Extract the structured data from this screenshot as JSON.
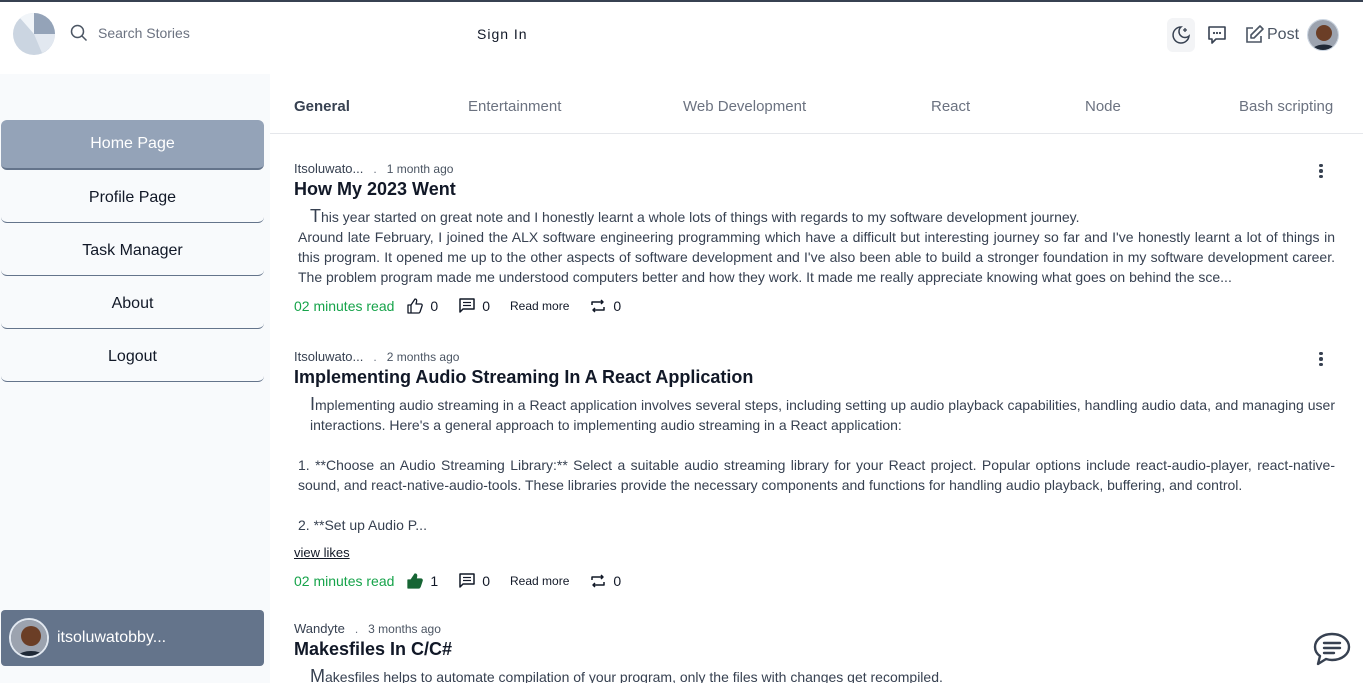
{
  "header": {
    "search_placeholder": "Search Stories",
    "signin_label": "Sign In",
    "post_label": "Post"
  },
  "sidebar": {
    "items": [
      {
        "label": "Home Page"
      },
      {
        "label": "Profile Page"
      },
      {
        "label": "Task Manager"
      },
      {
        "label": "About"
      },
      {
        "label": "Logout"
      }
    ],
    "user_name": "itsoluwatobby..."
  },
  "tabs": [
    {
      "label": "General"
    },
    {
      "label": "Entertainment"
    },
    {
      "label": "Web Development"
    },
    {
      "label": "React"
    },
    {
      "label": "Node"
    },
    {
      "label": "Bash scripting"
    }
  ],
  "posts": [
    {
      "author": "Itsoluwato...",
      "sep": ".",
      "ago": "1 month ago",
      "title": "How My 2023 Went",
      "p1": "This year started on great note and I honestly learnt a whole lots of things with regards to my software development journey.",
      "p2": "Around late February, I joined the ALX software engineering programming which have a difficult but interesting journey so far and I've honestly learnt a lot of things in this program. It opened me up to the other aspects of software development and I've also been able to build a stronger foundation in my software development career. The problem program made me understood computers better and how they work. It made me really appreciate knowing what goes on behind the sce...",
      "read_time": "02 minutes read",
      "likes": "0",
      "comments": "0",
      "read_more": "Read more",
      "shares": "0"
    },
    {
      "author": "Itsoluwato...",
      "sep": ".",
      "ago": "2 months ago",
      "title": "Implementing Audio Streaming In A React Application",
      "p1": "Implementing audio streaming in a React application involves several steps, including setting up audio playback capabilities, handling audio data, and managing user interactions. Here's a general approach to implementing audio streaming in a React application:",
      "p2": "1. **Choose an Audio Streaming Library:** Select a suitable audio streaming library for your React project. Popular options include react-audio-player, react-native-sound, and react-native-audio-tools. These libraries provide the necessary components and functions for handling audio playback, buffering, and control.",
      "p3": "2. **Set up Audio P...",
      "view_likes": "view likes",
      "read_time": "02 minutes read",
      "likes": "1",
      "comments": "0",
      "read_more": "Read more",
      "shares": "0"
    },
    {
      "author": "Wandyte",
      "sep": ".",
      "ago": "3 months ago",
      "title": "Makesfiles In C/C#",
      "p1": "Makesfiles helps to automate compilation of your program, only the files with changes get recompiled."
    }
  ],
  "colors": {
    "accent_green": "#16a34a",
    "nav_active": "#94a3b8",
    "user_card": "#64748b"
  },
  "icons": [
    "logo-icon",
    "search-icon",
    "moon-icon",
    "chat-icon",
    "edit-icon",
    "kebab-icon",
    "thumbs-up-icon",
    "comment-icon",
    "repost-icon",
    "chat-bubble-icon"
  ]
}
